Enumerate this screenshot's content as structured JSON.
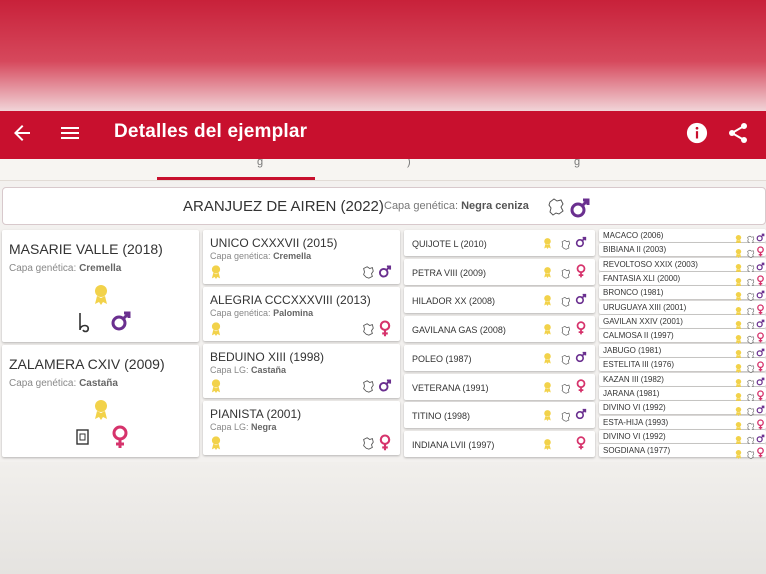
{
  "appbar": {
    "title": "Detalles del ejemplar"
  },
  "tabs": {
    "fragments": [
      "g",
      ")",
      "g"
    ]
  },
  "main": {
    "name": "ARANJUEZ DE AIREN (2022)",
    "capa_label": "Capa genética:",
    "capa_value": "Negra ceniza",
    "sex": "male"
  },
  "parents": [
    {
      "name": "MASARIE VALLE (2018)",
      "capa_label": "Capa genética:",
      "capa_value": "Cremella",
      "sex": "male"
    },
    {
      "name": "ZALAMERA CXIV (2009)",
      "capa_label": "Capa genética:",
      "capa_value": "Castaña",
      "sex": "female"
    }
  ],
  "grandparents": [
    {
      "name": "UNICO CXXXVII (2015)",
      "capa_label": "Capa genética:",
      "capa_value": "Cremella",
      "sex": "male"
    },
    {
      "name": "ALEGRIA CCCXXXVIII (2013)",
      "capa_label": "Capa genética:",
      "capa_value": "Palomina",
      "sex": "female"
    },
    {
      "name": "BEDUINO XIII (1998)",
      "capa_label": "Capa LG:",
      "capa_value": "Castaña",
      "sex": "male"
    },
    {
      "name": "PIANISTA (2001)",
      "capa_label": "Capa LG:",
      "capa_value": "Negra",
      "sex": "female"
    }
  ],
  "great_grandparents": [
    {
      "name": "QUIJOTE L (2010)",
      "sex": "male"
    },
    {
      "name": "PETRA VIII (2009)",
      "sex": "female"
    },
    {
      "name": "HILADOR XX (2008)",
      "sex": "male"
    },
    {
      "name": "GAVILANA GAS (2008)",
      "sex": "female"
    },
    {
      "name": "POLEO (1987)",
      "sex": "male"
    },
    {
      "name": "VETERANA (1991)",
      "sex": "female"
    },
    {
      "name": "TITINO (1998)",
      "sex": "male"
    },
    {
      "name": "INDIANA LVII (1997)",
      "sex": "female"
    }
  ],
  "g4": [
    {
      "name": "MACACO (2006)",
      "sex": "male"
    },
    {
      "name": "BIBIANA II (2003)",
      "sex": "female"
    },
    {
      "name": "REVOLTOSO XXIX (2003)",
      "sex": "male"
    },
    {
      "name": "FANTASIA XLI (2000)",
      "sex": "female"
    },
    {
      "name": "BRONCO (1981)",
      "sex": "male"
    },
    {
      "name": "URUGUAYA XIII (2001)",
      "sex": "female"
    },
    {
      "name": "GAVILAN XXIV (2001)",
      "sex": "male"
    },
    {
      "name": "CALMOSA II (1997)",
      "sex": "female"
    },
    {
      "name": "JABUGO (1981)",
      "sex": "male"
    },
    {
      "name": "ESTELITA III (1976)",
      "sex": "female"
    },
    {
      "name": "KAZAN III (1982)",
      "sex": "male"
    },
    {
      "name": "JARANA (1981)",
      "sex": "female"
    },
    {
      "name": "DIVINO VI (1992)",
      "sex": "male"
    },
    {
      "name": "ESTA-HIJA (1993)",
      "sex": "female"
    },
    {
      "name": "DIVINO VI (1992)",
      "sex": "male"
    },
    {
      "name": "SOGDIANA (1977)",
      "sex": "female"
    }
  ],
  "colors": {
    "brand": "#c8102e",
    "male": "#6a2f8f",
    "female": "#d6336c",
    "award": "#f2d24a"
  },
  "icons": [
    "arrow-back-icon",
    "hamburger-menu-icon",
    "info-icon",
    "share-icon",
    "award-ribbon-icon",
    "male-symbol-icon",
    "female-symbol-icon",
    "province-map-icon"
  ]
}
